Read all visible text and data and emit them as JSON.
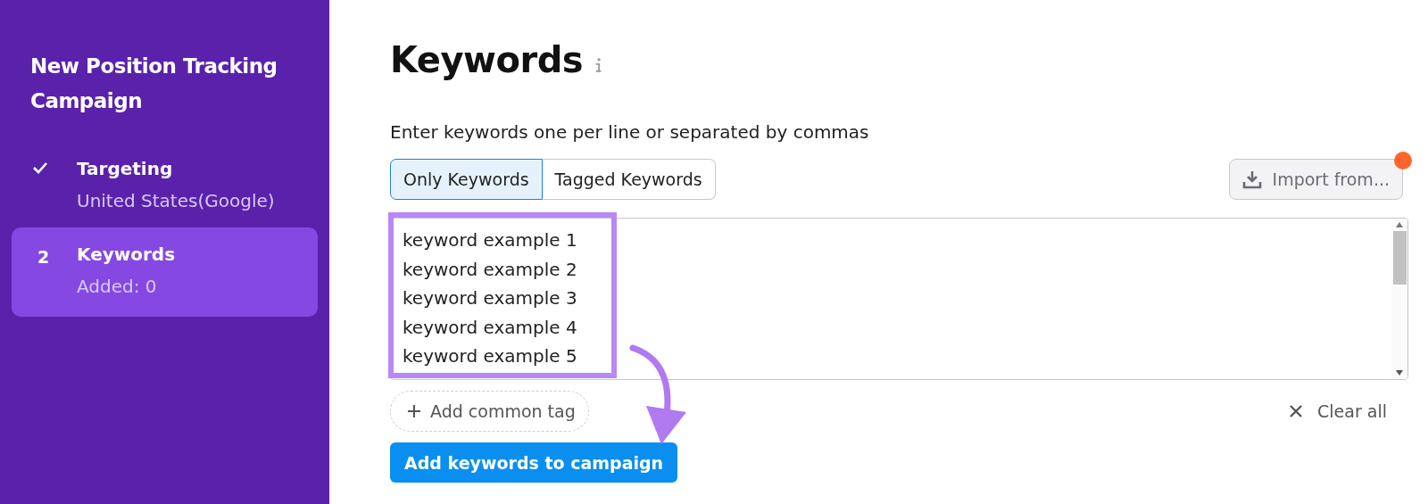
{
  "sidebar": {
    "title": "New Position Tracking Campaign",
    "steps": [
      {
        "kind": "done",
        "title": "Targeting",
        "subtitle": "United States(Google)",
        "selected": false
      },
      {
        "kind": "number",
        "number": "2",
        "title": "Keywords",
        "subtitle": "Added: 0",
        "selected": true
      }
    ]
  },
  "main": {
    "title": "Keywords",
    "instruction": "Enter keywords one per line or separated by commas",
    "tabs": [
      {
        "label": "Only Keywords",
        "selected": true
      },
      {
        "label": "Tagged Keywords",
        "selected": false
      }
    ],
    "import_button": {
      "label": "Import from...",
      "notification": true
    },
    "keywords": [
      "keyword example 1",
      "keyword example 2",
      "keyword example 3",
      "keyword example 4",
      "keyword example 5"
    ],
    "highlight": true,
    "add_tag": "Add common tag",
    "clear_all": "Clear all",
    "submit": "Add keywords to campaign"
  }
}
